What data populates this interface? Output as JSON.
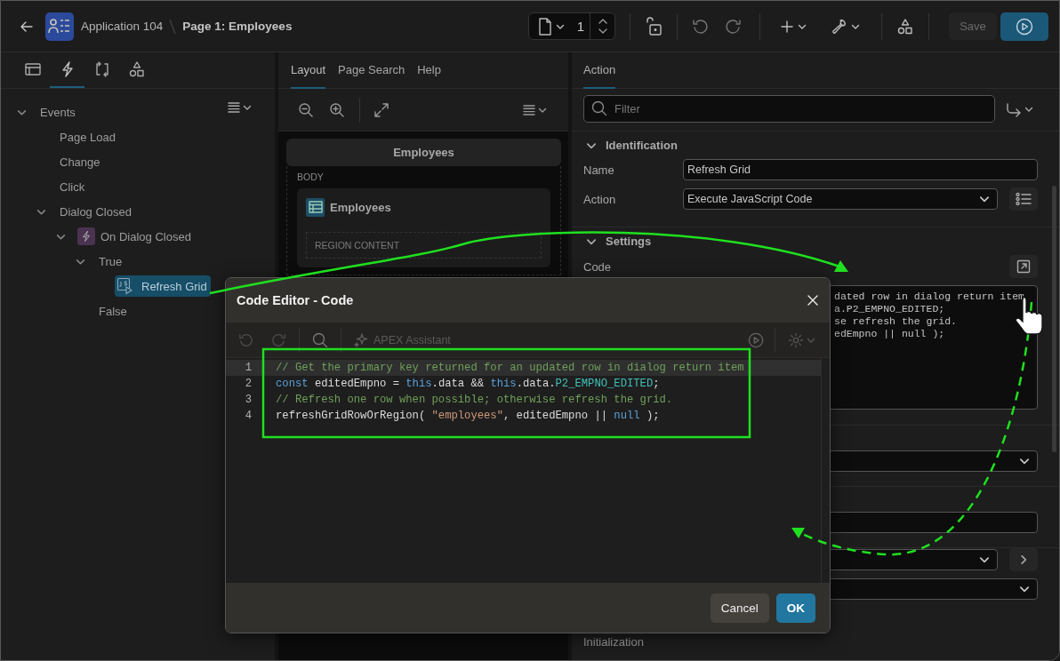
{
  "header": {
    "app_name": "Application 104",
    "page_title": "Page 1: Employees"
  },
  "toolbar": {
    "page_number": "1",
    "save": {
      "label": "Save",
      "disabled": true
    }
  },
  "left_tabs": [
    {
      "kind": "layout",
      "selected": false
    },
    {
      "kind": "lightning",
      "selected": true
    },
    {
      "kind": "loop",
      "selected": false
    },
    {
      "kind": "shapes",
      "selected": false
    }
  ],
  "tree": [
    {
      "label": "Events",
      "expanded": true,
      "selected": false,
      "children": [
        {
          "label": "Page Load",
          "selected": false
        },
        {
          "label": "Change",
          "selected": false
        },
        {
          "label": "Click",
          "selected": false
        },
        {
          "label": "Dialog Closed",
          "expanded": true,
          "selected": false,
          "children": [
            {
              "label": "On Dialog Closed",
              "kind": "event",
              "expanded": true,
              "selected": false,
              "children": [
                {
                  "label": "True",
                  "expanded": true,
                  "selected": false,
                  "children": [
                    {
                      "label": "Refresh Grid",
                      "kind": "action",
                      "selected": true
                    }
                  ]
                },
                {
                  "label": "False",
                  "selected": false
                }
              ]
            }
          ]
        }
      ]
    }
  ],
  "layout_tabs": [
    {
      "label": "Layout",
      "selected": true
    },
    {
      "label": "Page Search",
      "selected": false
    },
    {
      "label": "Help",
      "selected": false
    }
  ],
  "layout_canvas": {
    "page_title": "Employees",
    "body_label": "BODY",
    "region": {
      "title": "Employees",
      "content_label": "REGION CONTENT"
    }
  },
  "property_tabs": [
    {
      "label": "Action",
      "selected": true
    }
  ],
  "filter": {
    "placeholder": "Filter"
  },
  "sections": [
    {
      "title": "Identification",
      "expanded": true,
      "fields": [
        {
          "label": "Name",
          "kind": "text",
          "value": "Refresh Grid"
        },
        {
          "label": "Action",
          "kind": "select",
          "value": "Execute JavaScript Code"
        }
      ]
    },
    {
      "title": "Settings",
      "expanded": true,
      "fields": [
        {
          "label": "Code",
          "kind": "code",
          "lines": [
            "dated row in dialog return item",
            "a.P2_EMPNO_EDITED;",
            "se refresh the grid.",
            "edEmpno || null );"
          ]
        }
      ]
    }
  ],
  "obscured_fields": [
    {
      "kind": "select",
      "divider": true
    },
    {
      "kind": "text",
      "divider": true
    },
    {
      "kind": "select-next",
      "divider": false
    },
    {
      "kind": "select",
      "divider": false
    }
  ],
  "initialization_label": "Initialization",
  "dialog": {
    "title": "Code Editor - Code",
    "assistant_label": "APEX Assistant",
    "lines": [
      {
        "number": "1",
        "active": true,
        "tokens": [
          {
            "kind": "comment",
            "text": "// Get the primary key returned for an updated row in dialog return item"
          }
        ]
      },
      {
        "number": "2",
        "active": false,
        "tokens": [
          {
            "kind": "keyword",
            "text": "const"
          },
          {
            "kind": "plain",
            "text": " editedEmpno = "
          },
          {
            "kind": "keyword",
            "text": "this"
          },
          {
            "kind": "plain",
            "text": ".data && "
          },
          {
            "kind": "keyword",
            "text": "this"
          },
          {
            "kind": "plain",
            "text": ".data."
          },
          {
            "kind": "property",
            "text": "P2_EMPNO_EDITED"
          },
          {
            "kind": "plain",
            "text": ";"
          }
        ]
      },
      {
        "number": "3",
        "active": false,
        "tokens": [
          {
            "kind": "comment",
            "text": "// Refresh one row when possible; otherwise refresh the grid."
          }
        ]
      },
      {
        "number": "4",
        "active": false,
        "tokens": [
          {
            "kind": "plain",
            "text": "refreshGridRowOrRegion( "
          },
          {
            "kind": "string",
            "text": "\"employees\""
          },
          {
            "kind": "plain",
            "text": ", editedEmpno || "
          },
          {
            "kind": "keyword",
            "text": "null"
          },
          {
            "kind": "plain",
            "text": " );"
          }
        ]
      }
    ],
    "buttons": [
      {
        "label": "Cancel",
        "kind": "secondary"
      },
      {
        "label": "OK",
        "kind": "primary"
      }
    ]
  }
}
